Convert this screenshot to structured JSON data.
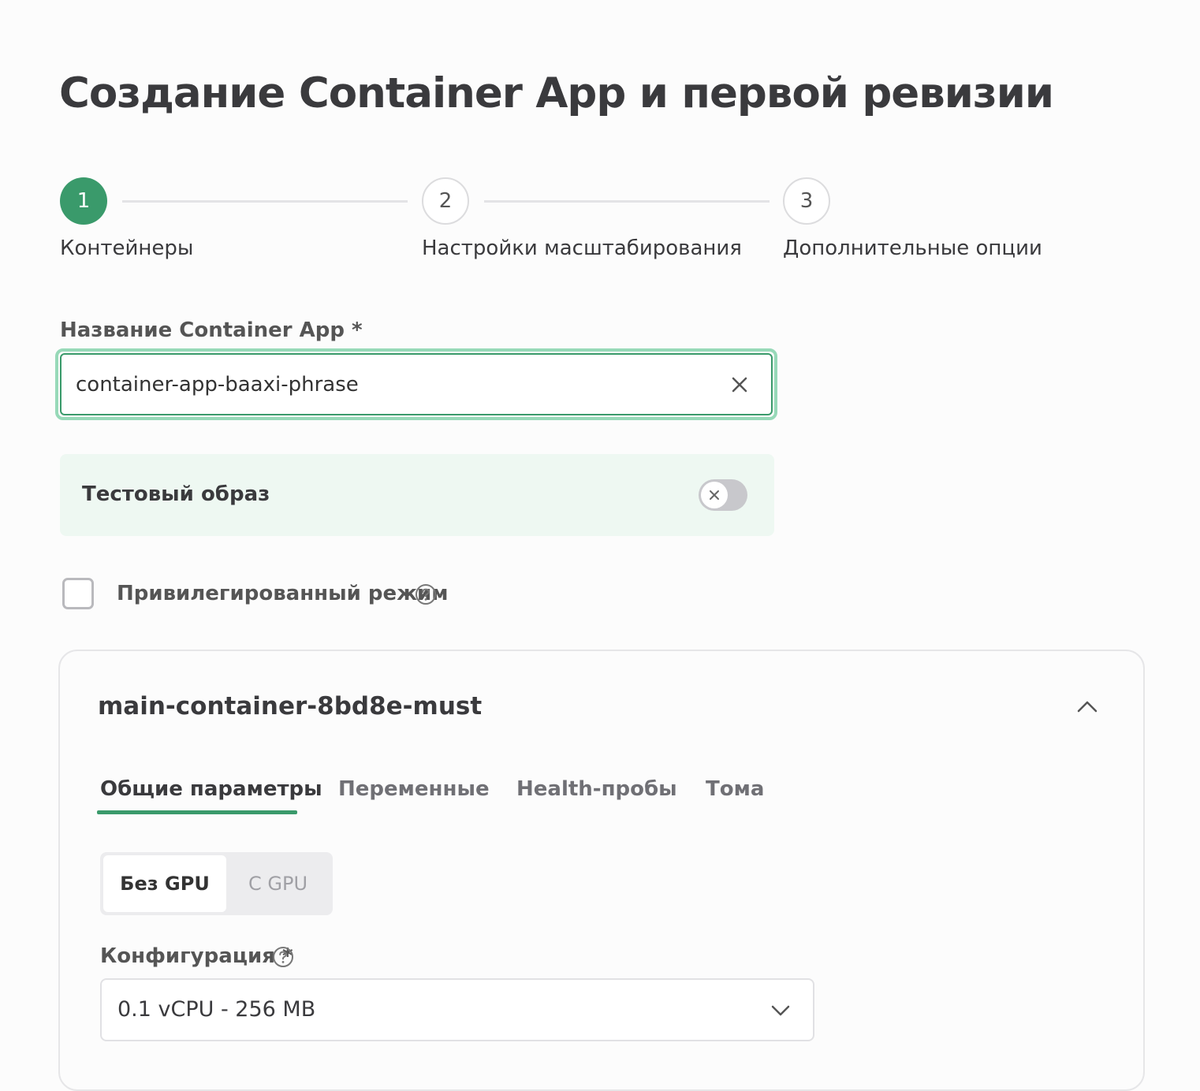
{
  "page": {
    "title": "Создание Container App и первой ревизии"
  },
  "stepper": {
    "steps": [
      {
        "number": "1",
        "label": "Контейнеры",
        "state": "active"
      },
      {
        "number": "2",
        "label": "Настройки масштабирования",
        "state": "pending"
      },
      {
        "number": "3",
        "label": "Дополнительные опции",
        "state": "pending"
      }
    ]
  },
  "app_name": {
    "label": "Название Container App *",
    "value": "container-app-baaxi-phrase",
    "clear_icon": "close-icon"
  },
  "test_image": {
    "label": "Тестовый образ",
    "enabled": false
  },
  "privileged_mode": {
    "label": "Привилегированный режим",
    "checked": false,
    "help_icon": "question-circle-icon"
  },
  "container": {
    "name": "main-container-8bd8e-must",
    "expanded": true,
    "tabs": [
      {
        "label": "Общие параметры",
        "active": true
      },
      {
        "label": "Переменные",
        "active": false
      },
      {
        "label": "Health-пробы",
        "active": false
      },
      {
        "label": "Тома",
        "active": false
      }
    ],
    "gpu_switch": {
      "options": [
        "Без GPU",
        "С GPU"
      ],
      "selected": "Без GPU"
    },
    "configuration": {
      "label": "Конфигурация *",
      "value": "0.1 vCPU - 256 MB",
      "help_icon": "question-circle-icon"
    }
  },
  "colors": {
    "accent": "#3a9a6b",
    "focus_ring": "#97d9b8",
    "panel_background": "#eef8f2"
  }
}
